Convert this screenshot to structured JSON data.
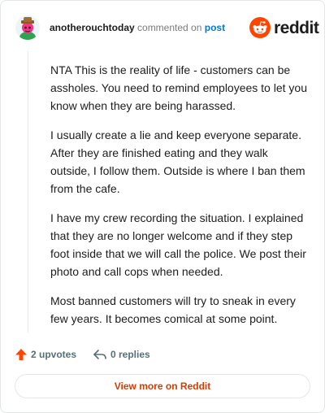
{
  "header": {
    "author": "anotherouchtoday",
    "action": "commented on",
    "post_link": "post",
    "brand": "reddit"
  },
  "comment": {
    "paragraphs": [
      "NTA This is the reality of life - customers can be assholes. You need to remind employees to let you know when they are being harassed.",
      "I usually create a lie and keep everyone separate. After they are finished eating and they walk outside, I follow them. Outside is where I ban them from the cafe.",
      "I have my crew recording the situation. I explained that they are no longer welcome and if they step foot inside that we will call the police. We post their photo and call cops when needed.",
      "Most banned customers will try to sneak in every few years. It becomes comical at some point."
    ]
  },
  "footer": {
    "upvotes": "2 upvotes",
    "replies": "0 replies",
    "view_more": "View more on Reddit"
  },
  "icons": {
    "avatar": "avatar-icon",
    "reddit_logo": "reddit-logo-icon",
    "upvote": "upvote-arrow-icon",
    "reply": "reply-arrow-icon"
  },
  "colors": {
    "accent": "#ff4500",
    "link": "#0079d3",
    "view_more": "#d93a00",
    "muted": "#576f76"
  }
}
